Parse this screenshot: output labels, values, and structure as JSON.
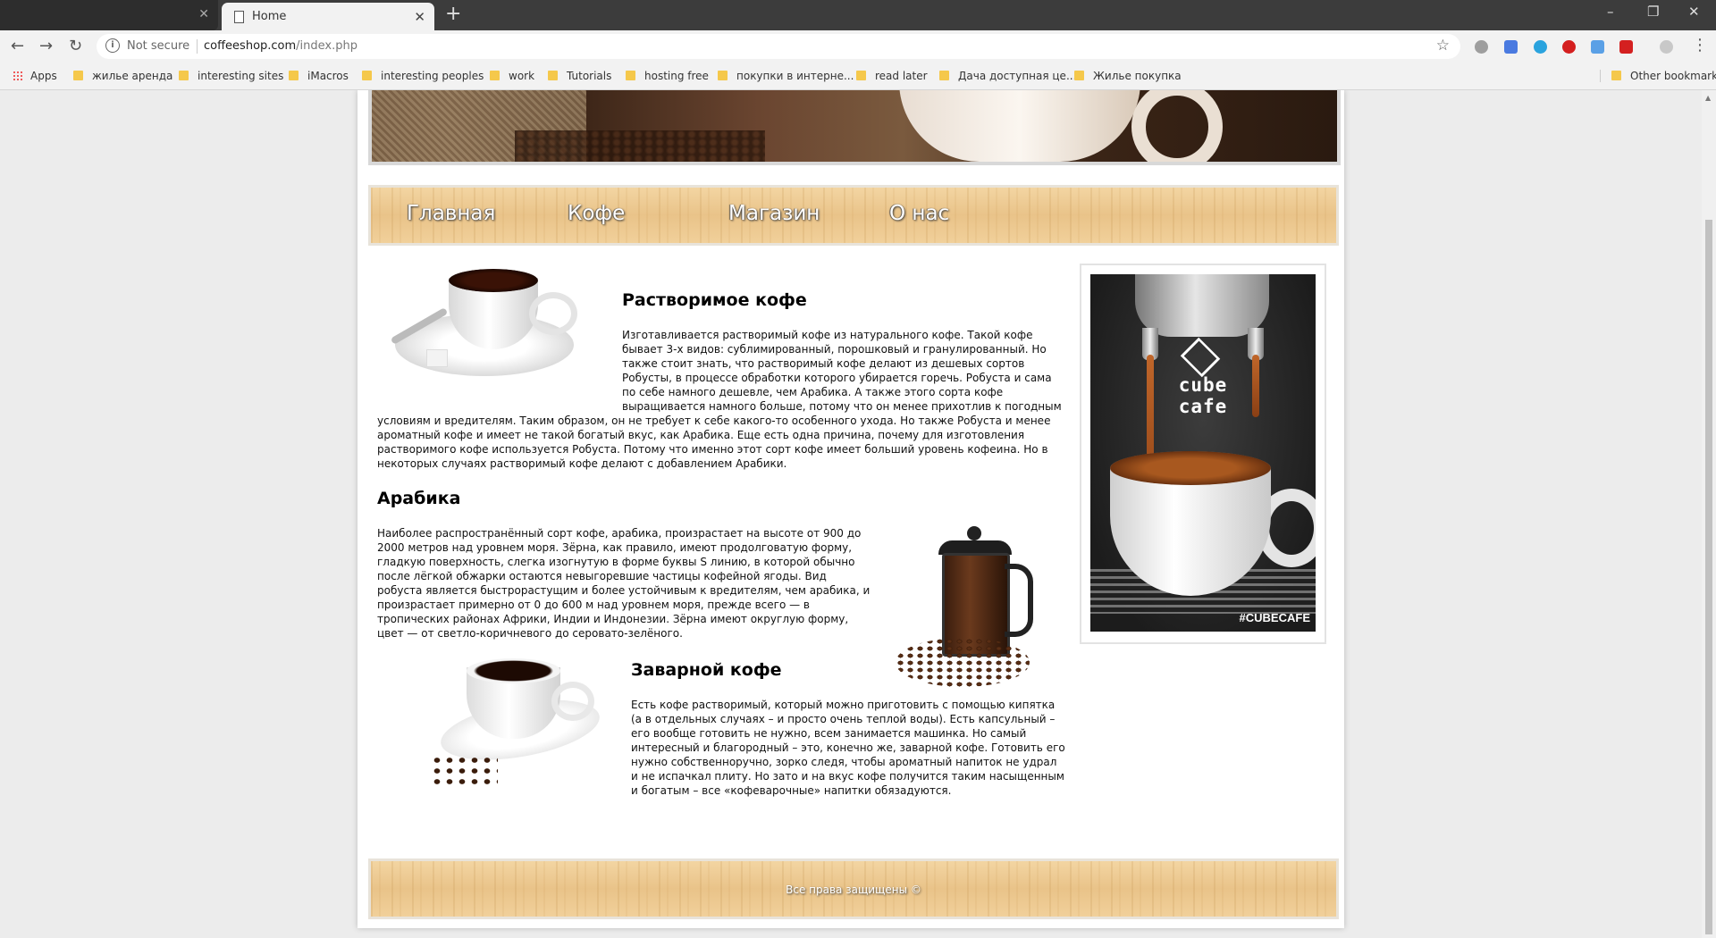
{
  "browser": {
    "tab_title": "Home",
    "security_label": "Not secure",
    "url_host": "coffeeshop.com",
    "url_path": "/index.php",
    "bookmarks": [
      "Apps",
      "жилье аренда",
      "interesting sites",
      "iMacros",
      "interesting peoples",
      "work",
      "Tutorials",
      "hosting free",
      "покупки в интерне...",
      "read later",
      "Дача доступная це...",
      "Жилье покупка"
    ],
    "other_bookmarks": "Other bookmarks"
  },
  "nav": {
    "items": [
      "Главная",
      "Кофе",
      "Магазин",
      "О нас"
    ]
  },
  "articles": [
    {
      "title": "Растворимое кофе",
      "text": "Изготавливается растворимый кофе из натурального кофе. Такой кофе бывает 3-х видов: сублимированный, порошковый и гранулированный. Но также стоит знать, что растворимый кофе делают из дешевых сортов Робусты, в процессе обработки которого убирается горечь. Робуста и сама по себе намного дешевле, чем Арабика. А также этого сорта кофе выращивается намного больше, потому что он менее прихотлив к погодным условиям и вредителям. Таким образом, он не требует к себе какого-то особенного ухода. Но также Робуста и менее ароматный кофе и имеет не такой богатый вкус, как Арабика. Еще есть одна причина, почему для изготовления растворимого кофе используется Робуста. Потому что именно этот сорт кофе имеет больший уровень кофеина. Но в некоторых случаях растворимый кофе делают с добавлением Арабики."
    },
    {
      "title": "Арабика",
      "text": "Наиболее распространённый сорт кофе, арабика, произрастает на высоте от 900 до 2000 метров над уровнем моря. Зёрна, как правило, имеют продолговатую форму, гладкую поверхность, слегка изогнутую в форме буквы S линию, в которой обычно после лёгкой обжарки остаются невыгоревшие частицы кофейной ягоды. Вид робуста является быстрорастущим и более устойчивым к вредителям, чем арабика, и произрастает примерно от 0 до 600 м над уровнем моря, прежде всего — в тропических районах Африки, Индии и Индонезии. Зёрна имеют округлую форму, цвет — от светло-коричневого до серовато-зелёного."
    },
    {
      "title": "Заварной кофе",
      "text": "Есть кофе растворимый, который можно приготовить с помощью кипятка (а в отдельных случаях – и просто очень теплой воды). Есть капсульный – его вообще готовить не нужно, всем занимается машинка. Но самый интересный и благородный – это, конечно же, заварной кофе. Готовить его нужно собственноручно, зорко следя, чтобы ароматный напиток не удрал и не испачкал плиту. Но зато и на вкус кофе получится таким насыщенным и богатым – все «кофеварочные» напитки обязадуются."
    }
  ],
  "sidebar": {
    "brand_line1": "cube",
    "brand_line2": "cafe",
    "hashtag": "#CUBECAFE"
  },
  "footer": {
    "copyright": "Все права защищены ©"
  }
}
